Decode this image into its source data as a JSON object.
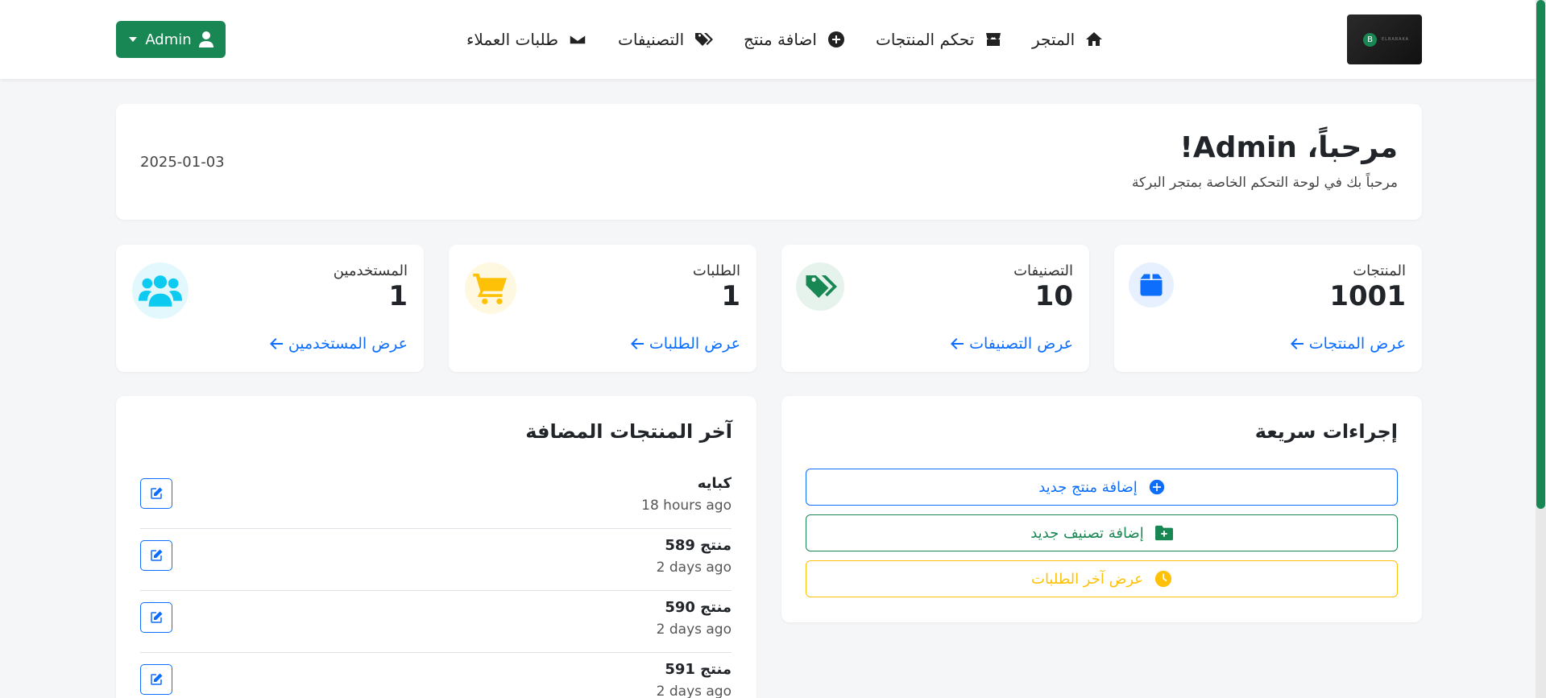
{
  "navbar": {
    "logo_text": "ELBARAKA",
    "items": [
      {
        "label": "المتجر",
        "icon": "home-icon"
      },
      {
        "label": "تحكم المنتجات",
        "icon": "store-icon"
      },
      {
        "label": "اضافة منتج",
        "icon": "plus-circle-icon"
      },
      {
        "label": "التصنيفات",
        "icon": "tags-icon"
      },
      {
        "label": "طلبات العملاء",
        "icon": "envelope-icon"
      }
    ],
    "admin_label": "Admin"
  },
  "welcome": {
    "title": "مرحباً، Admin!",
    "subtitle": "مرحباً بك في لوحة التحكم الخاصة بمتجر البركة",
    "date": "2025-01-03"
  },
  "stats": [
    {
      "label": "المنتجات",
      "value": "1001",
      "link": "عرض المنتجات",
      "icon": "box-icon",
      "color": "#0d6efd"
    },
    {
      "label": "التصنيفات",
      "value": "10",
      "link": "عرض التصنيفات",
      "icon": "tags-icon",
      "color": "#198754"
    },
    {
      "label": "الطلبات",
      "value": "1",
      "link": "عرض الطلبات",
      "icon": "cart-icon",
      "color": "#ffc107"
    },
    {
      "label": "المستخدمين",
      "value": "1",
      "link": "عرض المستخدمين",
      "icon": "users-icon",
      "color": "#0dcaf0"
    }
  ],
  "quick_actions": {
    "title": "إجراءات سريعة",
    "buttons": [
      {
        "label": "إضافة منتج جديد",
        "icon": "plus-circle-icon",
        "color": "#0d6efd"
      },
      {
        "label": "إضافة تصنيف جديد",
        "icon": "folder-plus-icon",
        "color": "#198754"
      },
      {
        "label": "عرض آخر الطلبات",
        "icon": "clock-icon",
        "color": "#ffc107"
      }
    ]
  },
  "latest_products": {
    "title": "آخر المنتجات المضافة",
    "items": [
      {
        "name": "كبايه",
        "time": "18 hours ago"
      },
      {
        "name": "منتج 589",
        "time": "2 days ago"
      },
      {
        "name": "منتج 590",
        "time": "2 days ago"
      },
      {
        "name": "منتج 591",
        "time": "2 days ago"
      }
    ]
  }
}
